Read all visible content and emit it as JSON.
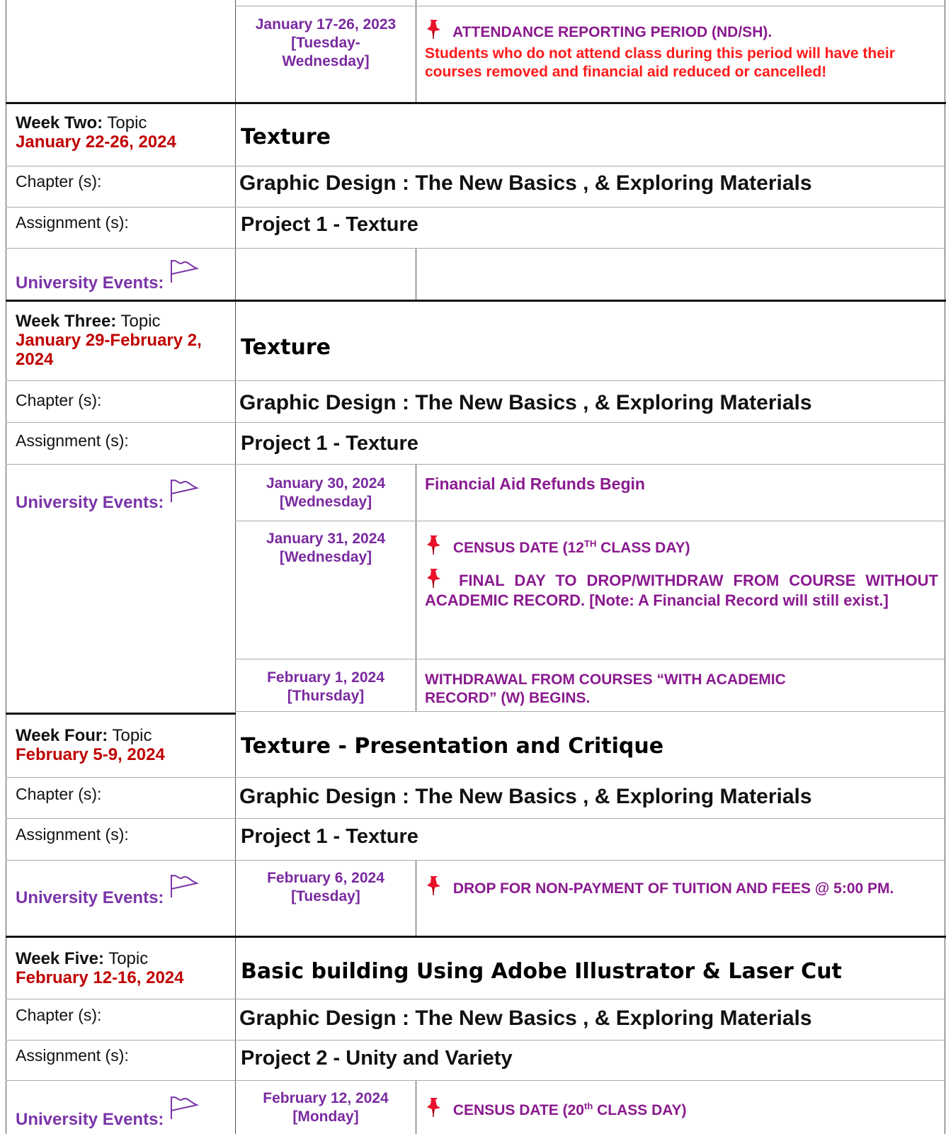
{
  "top_event": {
    "date": "January 17-26, 2023 [Tuesday-Wednesday]",
    "date_lines": [
      "January 17-26, 2023",
      "[Tuesday-",
      "Wednesday]"
    ],
    "title": "ATTENDANCE REPORTING PERIOD (ND/SH).",
    "warning": "Students who do not attend class during this period will have their courses removed and financial aid reduced or cancelled!"
  },
  "labels": {
    "topic_suffix": "Topic",
    "chapter": "Chapter (s):",
    "assignment": "Assignment (s):",
    "university_events": "University Events:"
  },
  "weeks": [
    {
      "name": "Week Two:",
      "dates": "January 22-26, 2024",
      "topic": "Texture",
      "chapter": "Graphic Design : The New Basics , & Exploring Materials",
      "assignment": "Project 1 - Texture",
      "events": []
    },
    {
      "name": "Week Three:",
      "dates": "January 29-February 2, 2024",
      "topic": "Texture",
      "chapter": "Graphic Design : The New Basics , & Exploring Materials",
      "assignment": "Project 1 - Texture",
      "events": [
        {
          "date": "January 30, 2024",
          "day": "[Wednesday]",
          "text": "Financial Aid Refunds Begin"
        },
        {
          "date": "January 31, 2024",
          "day": "[Wednesday]",
          "items": [
            {
              "pre": "CENSUS DATE (12",
              "sup": "TH",
              "post": " CLASS DAY)"
            },
            {
              "text": "FINAL DAY TO DROP/WITHDRAW FROM COURSE WITHOUT ACADEMIC RECORD. [Note: A Financial Record will still exist.]"
            }
          ]
        },
        {
          "date": "February 1, 2024",
          "day": "[Thursday]",
          "text": "WITHDRAWAL FROM COURSES “WITH ACADEMIC RECORD” (W) BEGINS."
        }
      ]
    },
    {
      "name": "Week Four:",
      "dates": "February 5-9, 2024",
      "topic": "Texture - Presentation and Critique",
      "chapter": "Graphic Design : The New Basics , & Exploring Materials",
      "assignment": "Project 1 - Texture",
      "events": [
        {
          "date": "February 6, 2024",
          "day": "[Tuesday]",
          "text": "DROP FOR NON-PAYMENT OF TUITION AND FEES @ 5:00 PM."
        }
      ]
    },
    {
      "name": "Week Five:",
      "dates": "February 12-16, 2024",
      "topic": "Basic building Using Adobe Illustrator & Laser Cut",
      "chapter": "Graphic Design : The New Basics , & Exploring Materials",
      "assignment": "Project 2 - Unity and Variety",
      "events": [
        {
          "date": "February 12, 2024",
          "day": "[Monday]",
          "pre": "CENSUS DATE (20",
          "sup": "th",
          "post": " CLASS DAY)"
        }
      ]
    }
  ],
  "icons": {
    "pin": "pushpin-icon",
    "flag": "pennant-flag-icon"
  },
  "colors": {
    "week_date": "#c00000",
    "events_label": "#7a35a8",
    "event_text": "#8a1a8f",
    "warning": "#ff1a1a"
  }
}
